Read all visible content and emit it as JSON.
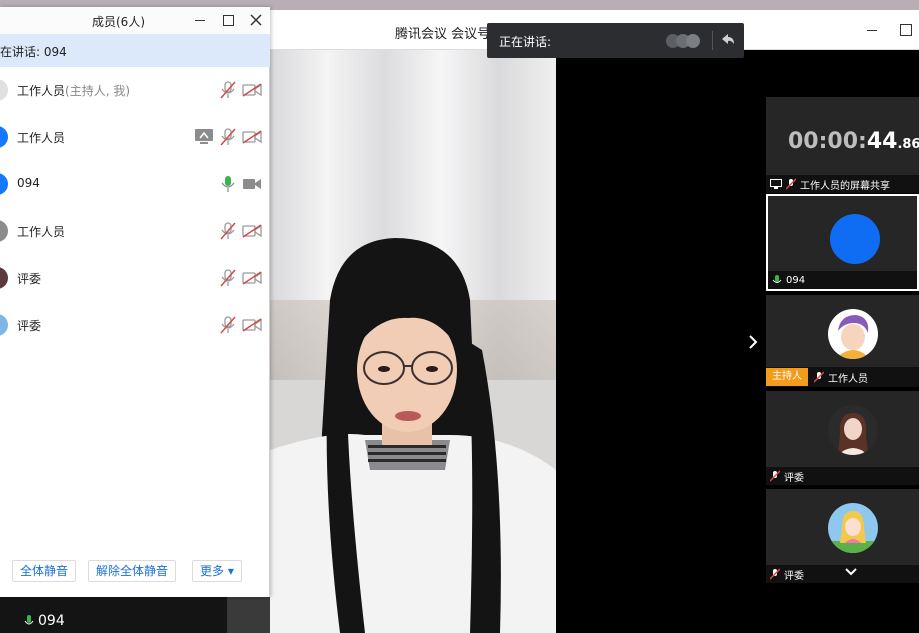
{
  "meeting": {
    "title": "腾讯会议 会议号"
  },
  "toast": {
    "speaking_label": "正在讲话:"
  },
  "members_panel": {
    "title": "成员(6人)",
    "speaking": "在讲话: 094",
    "members": [
      {
        "name": "工作人员",
        "note": "(主持人, 我)",
        "mic": "muted",
        "cam": "off",
        "share": false,
        "avatar_color": "#e0e0e0"
      },
      {
        "name": "工作人员",
        "note": "",
        "mic": "muted",
        "cam": "off",
        "share": true,
        "avatar_color": "#1677ff"
      },
      {
        "name": "094",
        "note": "",
        "mic": "on",
        "cam": "off-gray",
        "share": false,
        "avatar_color": "#1677ff"
      },
      {
        "name": "工作人员",
        "note": "",
        "mic": "muted",
        "cam": "off",
        "share": false,
        "avatar_color": "#8c8c8c"
      },
      {
        "name": "评委",
        "note": "",
        "mic": "muted",
        "cam": "off",
        "share": false,
        "avatar_color": "#5a3a3a"
      },
      {
        "name": "评委",
        "note": "",
        "mic": "muted",
        "cam": "off",
        "share": false,
        "avatar_color": "#7fb6e8"
      }
    ],
    "footer": {
      "mute_all": "全体静音",
      "unmute_all": "解除全体静音",
      "more": "更多 ▾"
    }
  },
  "strip": {
    "timer_dim": "00:00:",
    "timer_hi": "44",
    "timer_ms": ".86",
    "share_label": "工作人员的屏幕共享",
    "tile_094": "094",
    "host_badge": "主持人",
    "host_name": "工作人员",
    "judge1": "评委",
    "judge2": "评委"
  },
  "bottom_left": {
    "name": "094"
  },
  "colors": {
    "accent": "#1a6fd8",
    "mic_on": "#3cb34a",
    "mic_muted": "#d04a4a",
    "host_badge": "#f39b1a"
  }
}
